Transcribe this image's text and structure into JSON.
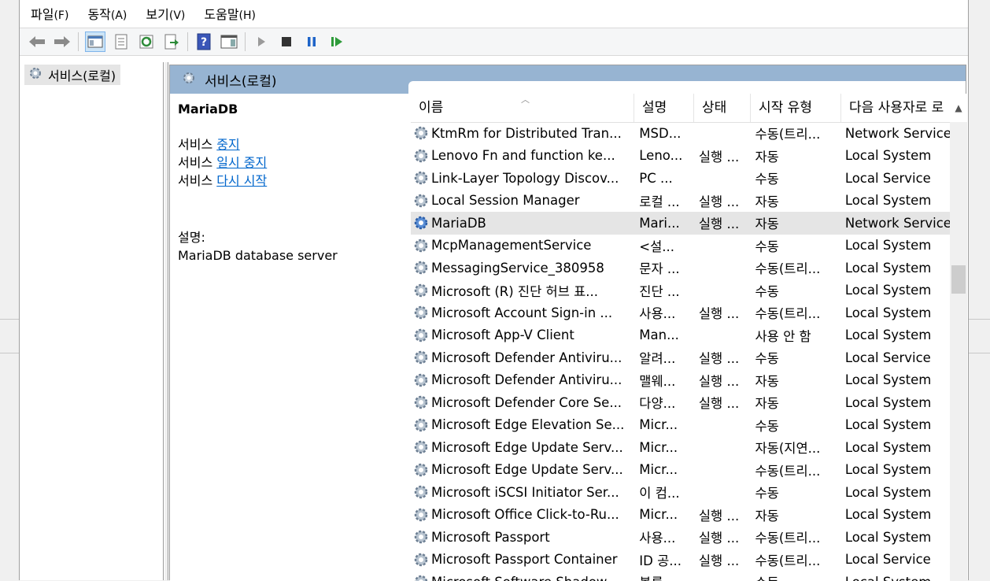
{
  "menu": [
    {
      "label": "파일",
      "accel": "(F)"
    },
    {
      "label": "동작",
      "accel": "(A)"
    },
    {
      "label": "보기",
      "accel": "(V)"
    },
    {
      "label": "도움말",
      "accel": "(H)"
    }
  ],
  "toolbar_icons": [
    "back-arrow-icon",
    "forward-arrow-icon",
    "console-tree-icon",
    "properties-icon",
    "refresh-icon",
    "export-list-icon",
    "help-icon",
    "show-hide-action-pane-icon",
    "start-service-icon",
    "stop-service-icon",
    "pause-service-icon",
    "resume-service-icon"
  ],
  "tree": {
    "label": "서비스(로컬)"
  },
  "pane": {
    "title": "서비스(로컬)"
  },
  "detail": {
    "service_name": "MariaDB",
    "prefix": "서비스",
    "stop_link": "중지",
    "pause_link": "일시 중지",
    "restart_link": "다시 시작",
    "desc_label": "설명:",
    "desc_text": "MariaDB database server"
  },
  "columns": {
    "name": "이름",
    "desc": "설명",
    "state": "상태",
    "start": "시작 유형",
    "logon": "다음 사용자로 로"
  },
  "rows": [
    {
      "name": "KtmRm for Distributed Tran...",
      "desc": "MSD...",
      "state": "",
      "start": "수동(트리...",
      "logon": "Network Service"
    },
    {
      "name": "Lenovo Fn and function ke...",
      "desc": "Leno...",
      "state": "실행 ...",
      "start": "자동",
      "logon": "Local System"
    },
    {
      "name": "Link-Layer Topology Discov...",
      "desc": "PC ...",
      "state": "",
      "start": "수동",
      "logon": "Local Service"
    },
    {
      "name": "Local Session Manager",
      "desc": "로컬 ...",
      "state": "실행 ...",
      "start": "자동",
      "logon": "Local System"
    },
    {
      "name": "MariaDB",
      "desc": "Mari...",
      "state": "실행 ...",
      "start": "자동",
      "logon": "Network Service",
      "selected": true
    },
    {
      "name": "McpManagementService",
      "desc": "<설...",
      "state": "",
      "start": "수동",
      "logon": "Local System"
    },
    {
      "name": "MessagingService_380958",
      "desc": "문자 ...",
      "state": "",
      "start": "수동(트리...",
      "logon": "Local System"
    },
    {
      "name": "Microsoft (R) 진단 허브 표...",
      "desc": "진단 ...",
      "state": "",
      "start": "수동",
      "logon": "Local System"
    },
    {
      "name": "Microsoft Account Sign-in ...",
      "desc": "사용...",
      "state": "실행 ...",
      "start": "수동(트리...",
      "logon": "Local System"
    },
    {
      "name": "Microsoft App-V Client",
      "desc": "Man...",
      "state": "",
      "start": "사용 안 함",
      "logon": "Local System"
    },
    {
      "name": "Microsoft Defender Antiviru...",
      "desc": "알려...",
      "state": "실행 ...",
      "start": "수동",
      "logon": "Local Service"
    },
    {
      "name": "Microsoft Defender Antiviru...",
      "desc": "맬웨...",
      "state": "실행 ...",
      "start": "자동",
      "logon": "Local System"
    },
    {
      "name": "Microsoft Defender Core Se...",
      "desc": "다양...",
      "state": "실행 ...",
      "start": "자동",
      "logon": "Local System"
    },
    {
      "name": "Microsoft Edge Elevation Se...",
      "desc": "Micr...",
      "state": "",
      "start": "수동",
      "logon": "Local System"
    },
    {
      "name": "Microsoft Edge Update Serv...",
      "desc": "Micr...",
      "state": "",
      "start": "자동(지연...",
      "logon": "Local System"
    },
    {
      "name": "Microsoft Edge Update Serv...",
      "desc": "Micr...",
      "state": "",
      "start": "수동(트리...",
      "logon": "Local System"
    },
    {
      "name": "Microsoft iSCSI Initiator Ser...",
      "desc": "이 컴...",
      "state": "",
      "start": "수동",
      "logon": "Local System"
    },
    {
      "name": "Microsoft Office Click-to-Ru...",
      "desc": "Micr...",
      "state": "실행 ...",
      "start": "자동",
      "logon": "Local System"
    },
    {
      "name": "Microsoft Passport",
      "desc": "사용...",
      "state": "실행 ...",
      "start": "수동(트리...",
      "logon": "Local System"
    },
    {
      "name": "Microsoft Passport Container",
      "desc": "ID 공...",
      "state": "실행 ...",
      "start": "수동(트리...",
      "logon": "Local Service"
    },
    {
      "name": "Microsoft Software Shadow...",
      "desc": "볼륨...",
      "state": "",
      "start": "수동",
      "logon": "Local System"
    }
  ],
  "colors": {
    "pane_header": "#97b4d2",
    "link": "#0066cc",
    "selected_row": "#e5e5e5"
  }
}
